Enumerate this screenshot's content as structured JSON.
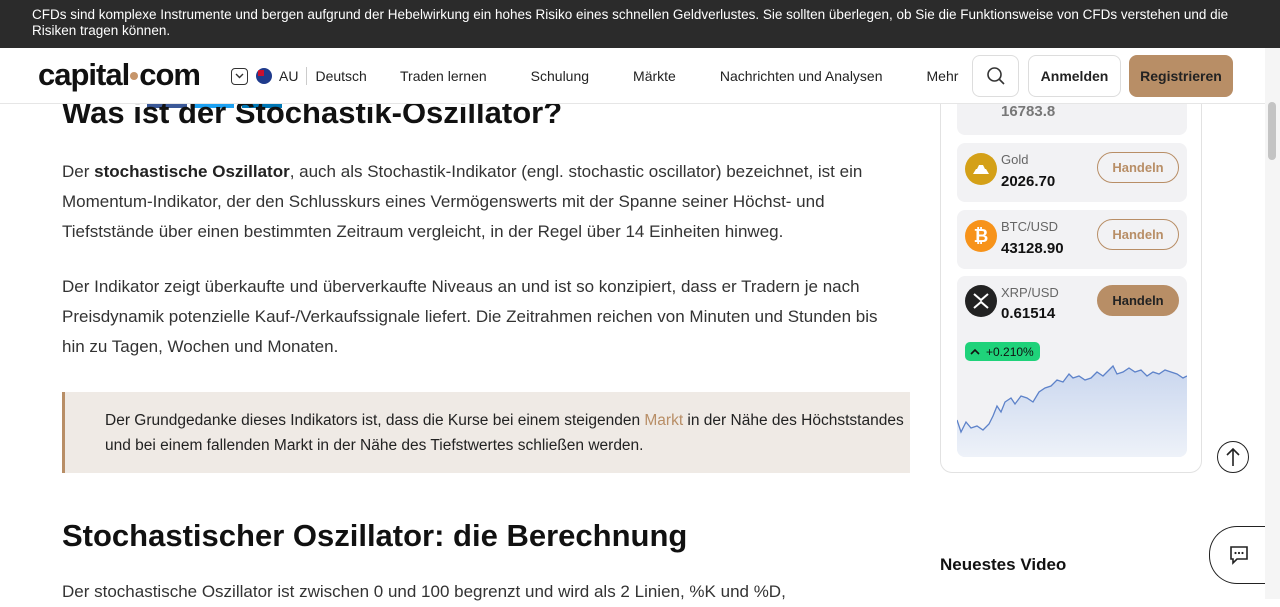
{
  "risk_warning": "CFDs sind komplexe Instrumente und bergen aufgrund der Hebelwirkung ein hohes Risiko eines schnellen Geldverlustes. Sie sollten überlegen, ob Sie die Funktionsweise von CFDs verstehen und die Risiken tragen können.",
  "header": {
    "logo_left": "capital",
    "logo_right": "com",
    "region": "AU",
    "language": "Deutsch",
    "nav": [
      "Traden lernen",
      "Schulung",
      "Märkte",
      "Nachrichten und Analysen",
      "Mehr"
    ],
    "login": "Anmelden",
    "register": "Registrieren"
  },
  "article": {
    "heading_partial": "Was ist der Stochastik-Oszillator?",
    "p1_bold": "stochastische Oszillator",
    "p1_pre": "Der ",
    "p1_post": ", auch als Stochastik-Indikator (engl. stochastic oscillator) bezeichnet, ist ein Momentum-Indikator, der den Schlusskurs eines Vermögenswerts mit der Spanne seiner Höchst- und Tiefststände über einen bestimmten Zeitraum vergleicht, in der Regel über 14 Einheiten hinweg.",
    "p2": "Der Indikator zeigt überkaufte und überverkaufte Niveaus an und ist so konzipiert, dass er Tradern je nach Preisdynamik potenzielle Kauf-/Verkaufssignale liefert. Die Zeitrahmen reichen von Minuten und Stunden bis hin zu Tagen, Wochen und Monaten.",
    "quote_pre": "Der Grundgedanke dieses Indikators ist, dass die Kurse bei einem steigenden ",
    "quote_link": "Markt",
    "quote_post": " in der Nähe des Höchststandes und bei einem fallenden Markt in der Nähe des Tiefstwertes schließen werden.",
    "heading2": "Stochastischer Oszillator: die Berechnung",
    "p3": "Der stochastische Oszillator ist zwischen 0 und 100 begrenzt und wird als 2 Linien, %K und %D,"
  },
  "widget": {
    "partial_price": "16783.8",
    "assets": [
      {
        "name": "Gold",
        "price": "2026.70",
        "button": "Handeln",
        "icon": "gold-icon",
        "color": "#d4a017"
      },
      {
        "name": "BTC/USD",
        "price": "43128.90",
        "button": "Handeln",
        "icon": "bitcoin-icon",
        "color": "#f7931a"
      },
      {
        "name": "XRP/USD",
        "price": "0.61514",
        "button": "Handeln",
        "icon": "xrp-icon",
        "color": "#222222"
      }
    ],
    "change": "+0.210%"
  },
  "sidebar": {
    "newest_video": "Neuestes Video"
  },
  "colors": {
    "accent": "#b88e66",
    "positive": "#1fd27a",
    "dark": "#2b2b2b"
  }
}
